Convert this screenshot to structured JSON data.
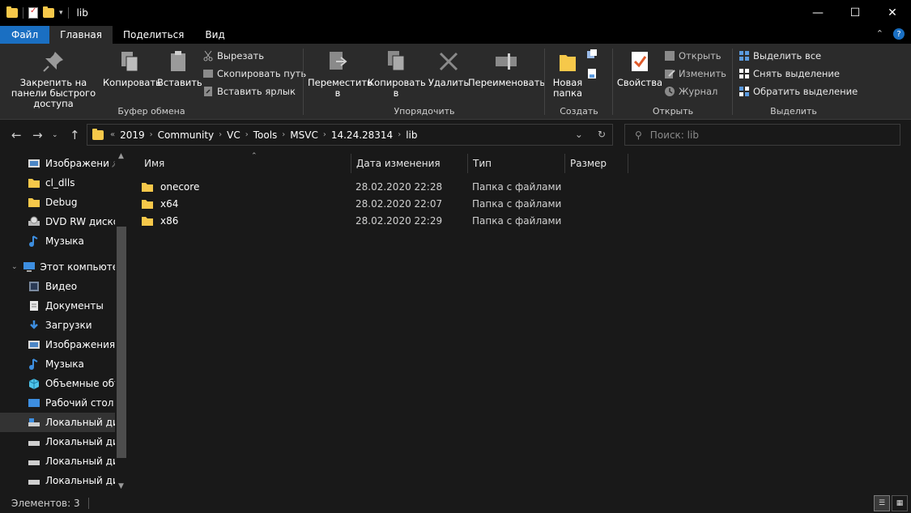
{
  "window": {
    "title": "lib",
    "minimize": "—",
    "maximize": "☐",
    "close": "✕"
  },
  "menu": {
    "tabs": [
      "Файл",
      "Главная",
      "Поделиться",
      "Вид"
    ],
    "expand_glyph": "⌃",
    "help_glyph": "?"
  },
  "ribbon": {
    "clipboard": {
      "label": "Буфер обмена",
      "pin": "Закрепить на панели быстрого доступа",
      "copy": "Копировать",
      "paste": "Вставить",
      "cut": "Вырезать",
      "copy_path": "Скопировать путь",
      "paste_shortcut": "Вставить ярлык"
    },
    "organize": {
      "label": "Упорядочить",
      "move_to": "Переместить в",
      "copy_to": "Копировать в",
      "delete": "Удалить",
      "rename": "Переименовать"
    },
    "new": {
      "label": "Создать",
      "new_folder": "Новая папка"
    },
    "open": {
      "label": "Открыть",
      "properties": "Свойства",
      "open": "Открыть",
      "edit": "Изменить",
      "history": "Журнал"
    },
    "select": {
      "label": "Выделить",
      "select_all": "Выделить все",
      "select_none": "Снять выделение",
      "invert": "Обратить выделение"
    }
  },
  "address": {
    "overflow": "«",
    "crumbs": [
      "2019",
      "Community",
      "VC",
      "Tools",
      "MSVC",
      "14.24.28314",
      "lib"
    ],
    "search_placeholder": "Поиск: lib"
  },
  "navpane": {
    "items": [
      {
        "label": "Изображени",
        "icon": "pictures-icon",
        "pinned": true
      },
      {
        "label": "cl_dlls",
        "icon": "folder-icon"
      },
      {
        "label": "Debug",
        "icon": "folder-icon"
      },
      {
        "label": "DVD RW дисков",
        "icon": "dvd-drive-icon"
      },
      {
        "label": "Музыка",
        "icon": "music-icon"
      },
      {
        "label": "Этот компьютер",
        "icon": "computer-icon"
      },
      {
        "label": "Видео",
        "icon": "video-icon"
      },
      {
        "label": "Документы",
        "icon": "documents-icon"
      },
      {
        "label": "Загрузки",
        "icon": "downloads-icon"
      },
      {
        "label": "Изображения",
        "icon": "pictures-icon"
      },
      {
        "label": "Музыка",
        "icon": "music-icon"
      },
      {
        "label": "Объемные объ",
        "icon": "3d-objects-icon"
      },
      {
        "label": "Рабочий стол",
        "icon": "desktop-icon"
      },
      {
        "label": "Локальный дис",
        "icon": "local-disk-icon",
        "selected": true
      },
      {
        "label": "Локальный дис",
        "icon": "local-disk-icon"
      },
      {
        "label": "Локальный дис",
        "icon": "local-disk-icon"
      },
      {
        "label": "Локальный дис",
        "icon": "local-disk-icon"
      }
    ]
  },
  "filelist": {
    "columns": [
      "Имя",
      "Дата изменения",
      "Тип",
      "Размер"
    ],
    "rows": [
      {
        "name": "onecore",
        "date": "28.02.2020 22:28",
        "type": "Папка с файлами"
      },
      {
        "name": "x64",
        "date": "28.02.2020 22:07",
        "type": "Папка с файлами"
      },
      {
        "name": "x86",
        "date": "28.02.2020 22:29",
        "type": "Папка с файлами"
      }
    ]
  },
  "status": {
    "items_count": "Элементов: 3"
  },
  "colors": {
    "accent": "#1a6fc2",
    "folder": "#f6c84a",
    "background": "#191919",
    "ribbon": "#2b2b2b"
  }
}
